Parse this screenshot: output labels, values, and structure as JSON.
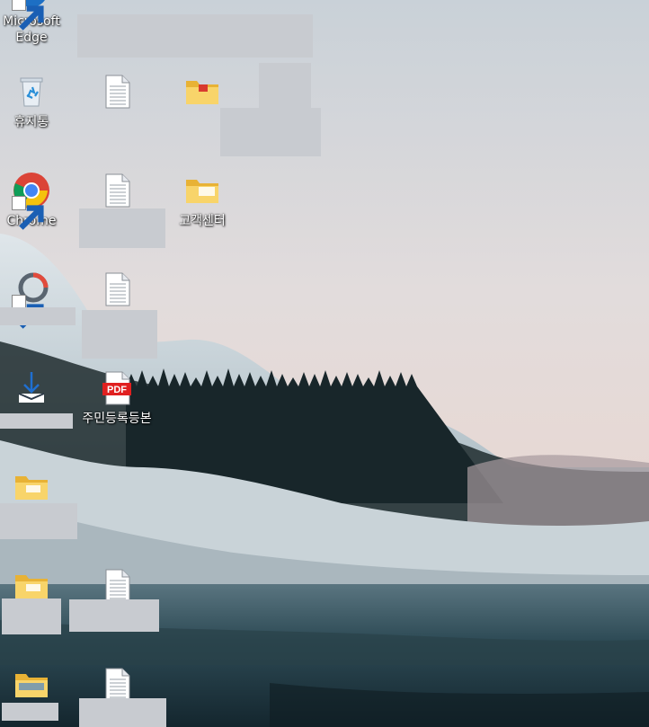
{
  "desktop": {
    "icons": {
      "edge": {
        "label_line1": "Microsoft",
        "label_line2": "Edge",
        "icon": "edge-icon"
      },
      "recycle": {
        "label": "휴지통",
        "icon": "recycle-bin-icon"
      },
      "chrome": {
        "label": "Chrome",
        "icon": "chrome-icon"
      },
      "camera_app": {
        "label": "",
        "icon": "camera-app-icon"
      },
      "installer": {
        "label": "",
        "icon": "download-tray-icon"
      },
      "folder_a": {
        "label": "",
        "icon": "folder-icon"
      },
      "folder_b": {
        "label": "",
        "icon": "folder-icon"
      },
      "folder_c": {
        "label": "",
        "icon": "folder-icon"
      },
      "doc_1": {
        "label": "",
        "icon": "document-icon"
      },
      "doc_2": {
        "label": "",
        "icon": "document-icon"
      },
      "doc_3": {
        "label": "",
        "icon": "document-icon"
      },
      "pdf": {
        "label": "주민등록등본",
        "icon": "pdf-icon",
        "badge": "PDF"
      },
      "doc_4": {
        "label": "",
        "icon": "document-icon"
      },
      "doc_5": {
        "label": "",
        "icon": "document-icon"
      },
      "folder_red": {
        "label": "",
        "icon": "folder-icon"
      },
      "folder_service": {
        "label": "고객센터",
        "icon": "folder-icon"
      }
    }
  }
}
